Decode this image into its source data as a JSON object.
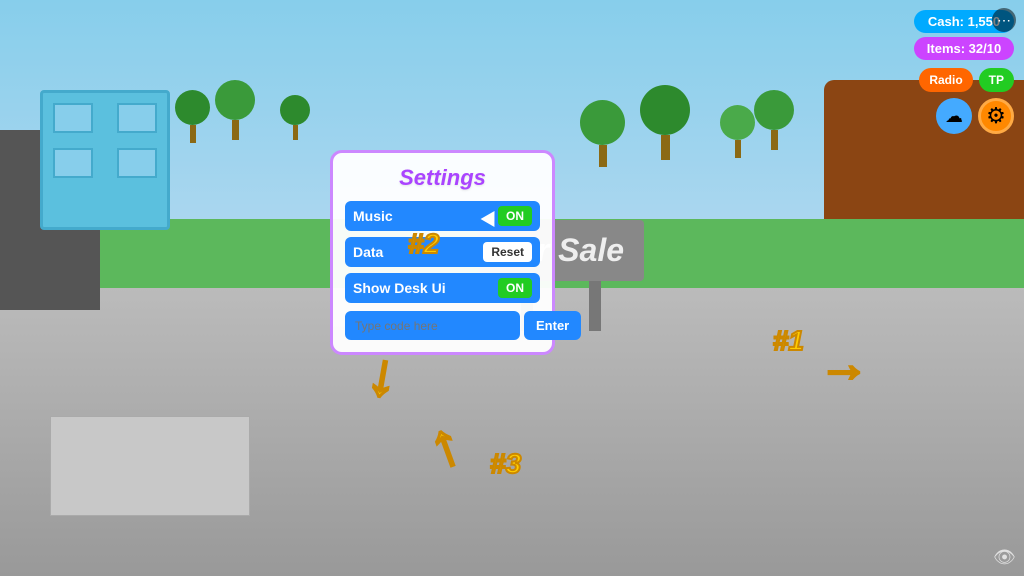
{
  "scene": {
    "background": "roblox-game-scene"
  },
  "settings_panel": {
    "title": "Settings",
    "rows": [
      {
        "label": "Music",
        "control_type": "toggle",
        "control_value": "ON"
      },
      {
        "label": "Data",
        "control_type": "reset",
        "control_value": "Reset"
      },
      {
        "label": "Show Desk Ui",
        "control_type": "toggle",
        "control_value": "ON"
      }
    ],
    "code_input_placeholder": "Type code here",
    "enter_button_label": "Enter"
  },
  "hud": {
    "cash_label": "Cash: 1,550",
    "items_label": "Items: 32/10",
    "radio_label": "Radio",
    "tp_label": "TP",
    "gear_icon": "⚙",
    "cloud_icon": "☁",
    "more_options_icon": "•••"
  },
  "for_sale": {
    "text": "For Sale"
  },
  "steps": {
    "step1": "#1",
    "step2": "#2",
    "step3": "#3"
  },
  "eye_icon": "👁"
}
